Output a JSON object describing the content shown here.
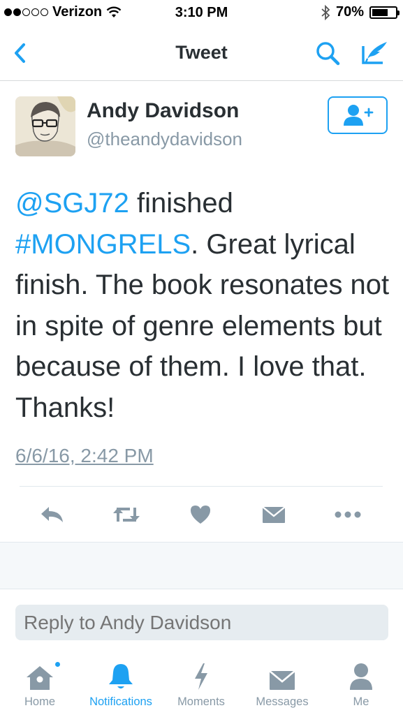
{
  "status_bar": {
    "carrier": "Verizon",
    "time": "3:10 PM",
    "battery_text": "70%",
    "battery_level": 0.7,
    "icons": [
      "signal-dots-icon",
      "wifi-icon",
      "bluetooth-icon",
      "battery-icon"
    ]
  },
  "nav": {
    "title": "Tweet",
    "icons": [
      "back-chevron-icon",
      "search-icon",
      "compose-icon"
    ]
  },
  "tweet": {
    "author_name": "Andy Davidson",
    "author_handle": "@theandydavidson",
    "text_parts": {
      "mention": "@SGJ72",
      "after_mention": " finished ",
      "hashtag": "#MONGRELS",
      "body": ". Great lyrical finish. The book resonates not in spite of genre elements but because of them. I love that. Thanks!"
    },
    "timestamp": "6/6/16, 2:42 PM",
    "actions": [
      "reply-icon",
      "retweet-icon",
      "like-icon",
      "direct-message-icon",
      "more-icon"
    ]
  },
  "reply": {
    "placeholder": "Reply to Andy Davidson"
  },
  "tab_bar": {
    "home": "Home",
    "notifications": "Notifications",
    "moments": "Moments",
    "messages": "Messages",
    "me": "Me",
    "active": "notifications"
  },
  "colors": {
    "accent": "#1da1f2",
    "text": "#292f33",
    "muted": "#8899a6",
    "divider": "#e1e8ed",
    "input_bg": "#e6ecf0"
  }
}
